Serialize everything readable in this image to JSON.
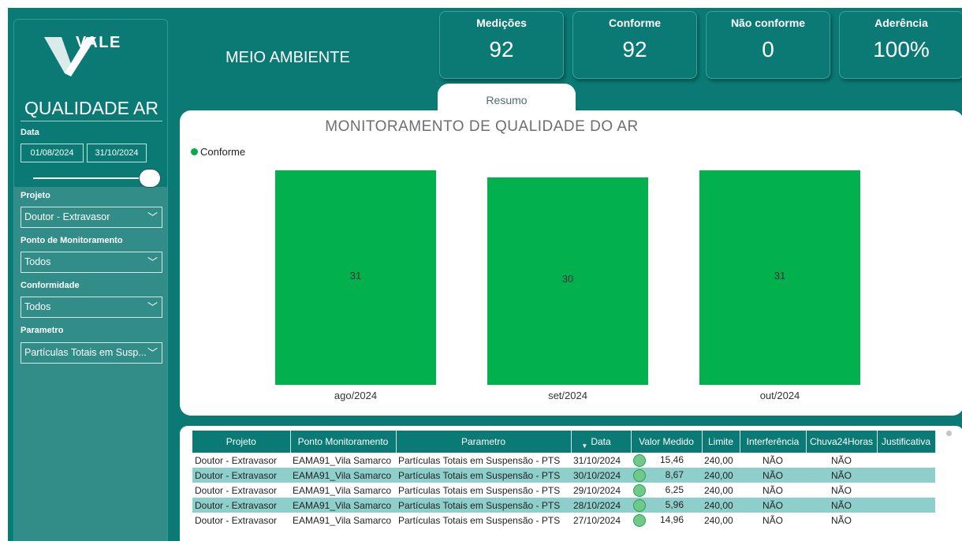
{
  "sidebar": {
    "logo_text": "VALE",
    "section_title": "QUALIDADE AR",
    "date_label": "Data",
    "date_start": "01/08/2024",
    "date_end": "31/10/2024",
    "filters": [
      {
        "label": "Projeto",
        "value": "Doutor - Extravasor"
      },
      {
        "label": "Ponto de Monitoramento",
        "value": "Todos"
      },
      {
        "label": "Conformidade",
        "value": "Todos"
      },
      {
        "label": "Parametro",
        "value": "Partículas Totais em Susp..."
      }
    ]
  },
  "header": {
    "title": "MEIO AMBIENTE"
  },
  "kpis": [
    {
      "title": "Medições",
      "value": "92"
    },
    {
      "title": "Conforme",
      "value": "92"
    },
    {
      "title": "Não conforme",
      "value": "0"
    },
    {
      "title": "Aderência",
      "value": "100%"
    }
  ],
  "tab": {
    "label": "Resumo"
  },
  "chart_data": {
    "type": "bar",
    "title": "MONITORAMENTO DE QUALIDADE DO AR",
    "categories": [
      "ago/2024",
      "set/2024",
      "out/2024"
    ],
    "series": [
      {
        "name": "Conforme",
        "values": [
          31,
          30,
          31
        ],
        "color": "#02b04d"
      }
    ],
    "ylim": [
      0,
      31
    ],
    "legend": "top-left"
  },
  "table": {
    "columns": [
      "Projeto",
      "Ponto Monitoramento",
      "Parametro",
      "Data",
      "Valor Medido",
      "Limite",
      "Interferência",
      "Chuva24Horas",
      "Justificativa"
    ],
    "rows": [
      [
        "Doutor - Extravasor",
        "EAMA91_Vila Samarco",
        "Partículas Totais em Suspensão - PTS",
        "31/10/2024",
        "15,46",
        "240,00",
        "NÃO",
        "NÃO",
        ""
      ],
      [
        "Doutor - Extravasor",
        "EAMA91_Vila Samarco",
        "Partículas Totais em Suspensão - PTS",
        "30/10/2024",
        "8,67",
        "240,00",
        "NÃO",
        "NÃO",
        ""
      ],
      [
        "Doutor - Extravasor",
        "EAMA91_Vila Samarco",
        "Partículas Totais em Suspensão - PTS",
        "29/10/2024",
        "6,25",
        "240,00",
        "NÃO",
        "NÃO",
        ""
      ],
      [
        "Doutor - Extravasor",
        "EAMA91_Vila Samarco",
        "Partículas Totais em Suspensão - PTS",
        "28/10/2024",
        "5,96",
        "240,00",
        "NÃO",
        "NÃO",
        ""
      ],
      [
        "Doutor - Extravasor",
        "EAMA91_Vila Samarco",
        "Partículas Totais em Suspensão - PTS",
        "27/10/2024",
        "14,96",
        "240,00",
        "NÃO",
        "NÃO",
        ""
      ]
    ]
  },
  "colors": {
    "teal": "#0b7a75",
    "bar_green": "#02b04d",
    "row_alt": "#8fcfcb"
  }
}
